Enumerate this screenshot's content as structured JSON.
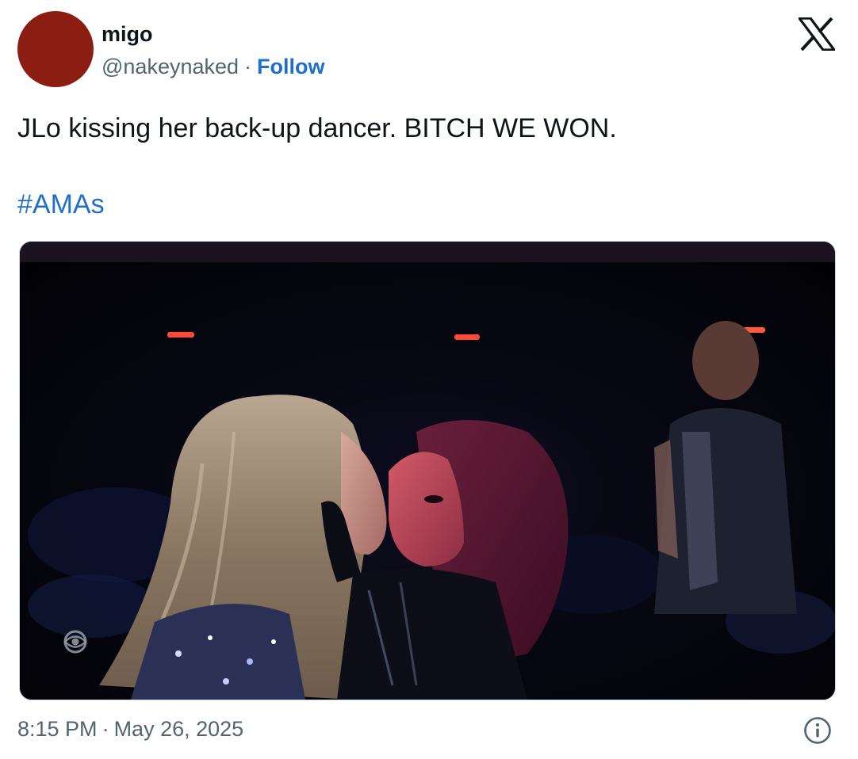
{
  "author": {
    "display_name": "migo",
    "handle": "@nakeynaked",
    "separator": "·",
    "follow_label": "Follow",
    "avatar_color": "#8c1d12"
  },
  "tweet": {
    "text": "JLo kissing her back-up dancer. BITCH WE WON.",
    "hashtag": "#AMAs"
  },
  "meta": {
    "time": "8:15 PM",
    "separator": "·",
    "date": "May 26, 2025"
  },
  "icons": {
    "brand": "x-logo-icon",
    "info": "info-icon",
    "network_watermark": "eye-logo-icon"
  },
  "colors": {
    "link": "#1d6fc9",
    "secondary_text": "#536471",
    "primary_text": "#0f1419"
  }
}
